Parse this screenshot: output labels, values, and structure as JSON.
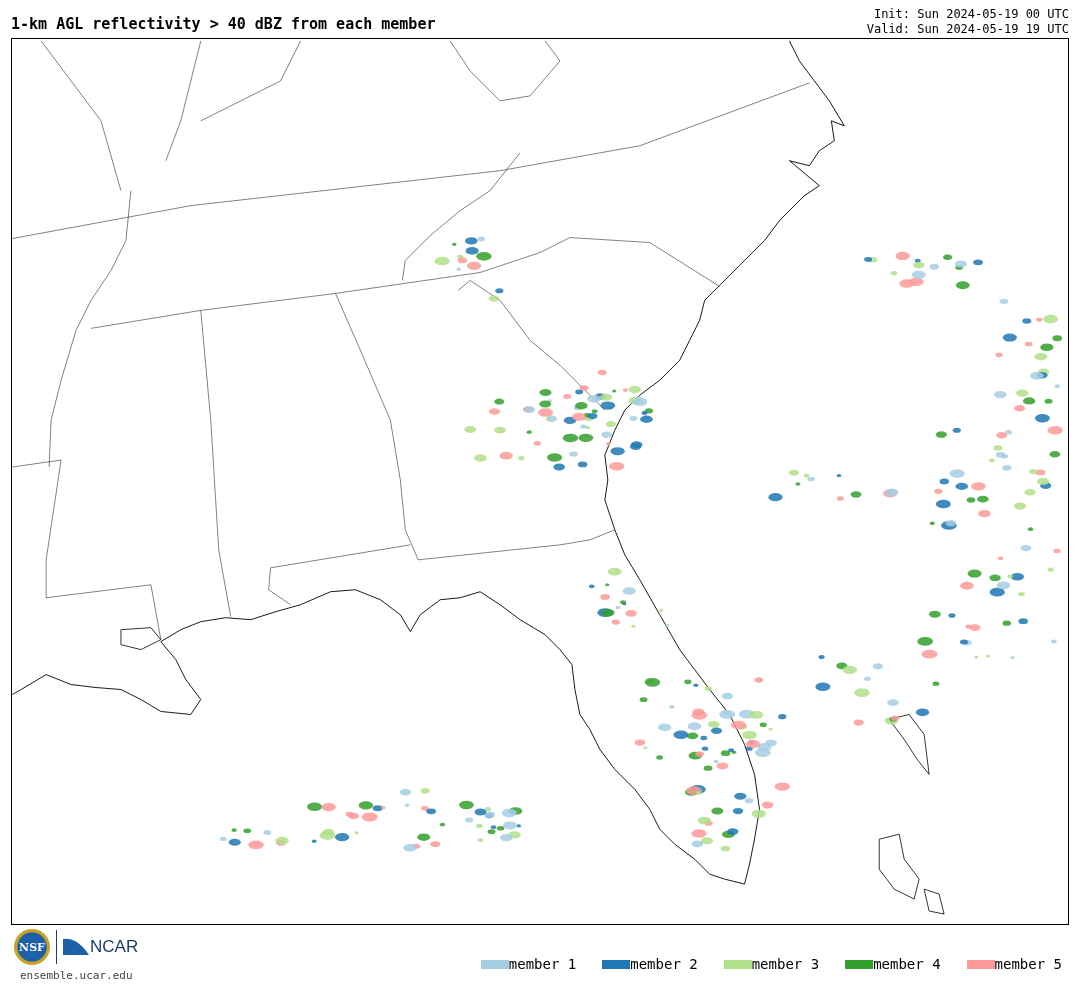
{
  "title": "1-km AGL reflectivity > 40 dBZ from each member",
  "init": "Init: Sun 2024-05-19 00 UTC",
  "valid": "Valid: Sun 2024-05-19 19 UTC",
  "logos": {
    "nsf": "NSF",
    "ncar": "NCAR"
  },
  "site": "ensemble.ucar.edu",
  "legend": [
    {
      "label": "member 1",
      "color": "#a6cee3"
    },
    {
      "label": "member 2",
      "color": "#1f78b4"
    },
    {
      "label": "member 3",
      "color": "#b2df8a"
    },
    {
      "label": "member 4",
      "color": "#33a02c"
    },
    {
      "label": "member 5",
      "color": "#fb9a99"
    }
  ]
}
